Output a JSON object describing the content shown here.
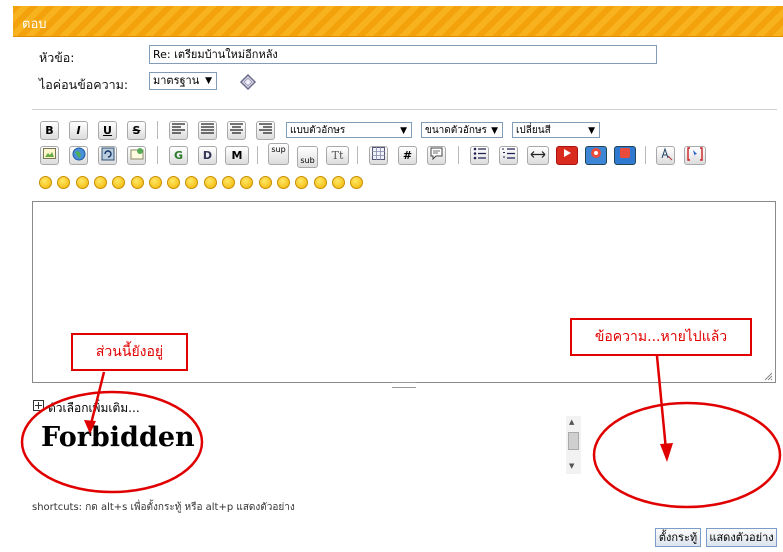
{
  "header": {
    "title": "ตอบ"
  },
  "form": {
    "subject_label": "หัวข้อ:",
    "subject_value": "Re: เตรียมบ้านใหม่อีกหลัง",
    "icon_label": "ไอค่อนข้อความ:",
    "icon_select_value": "มาตรฐาน"
  },
  "toolbar": {
    "bold": "B",
    "italic": "I",
    "underline": "U",
    "strike": "S",
    "font_select": "แบบตัวอักษร",
    "size_select": "ขนาดตัวอักษร",
    "color_select": "เปลี่ยนสี",
    "glow": "G",
    "shadow": "D",
    "marquee": "M",
    "sup": "sup",
    "sub": "sub",
    "teletype": "Tt",
    "hash": "#"
  },
  "annotations": {
    "left_callout": "ส่วนนี้ยังอยู่",
    "right_callout": "ข้อความ...หายไปแล้ว"
  },
  "more_options": "ตัวเลือกเพิ่มเติม...",
  "forbidden": "Forbidden",
  "shortcuts": "shortcuts: กด alt+s เพื่อตั้งกระทู้ หรือ alt+p แสดงตัวอย่าง",
  "buttons": {
    "post": "ตั้งกระทู้",
    "preview": "แสดงตัวอย่าง"
  },
  "colors": {
    "header": "#f3a20c",
    "annotation": "#e00000"
  }
}
